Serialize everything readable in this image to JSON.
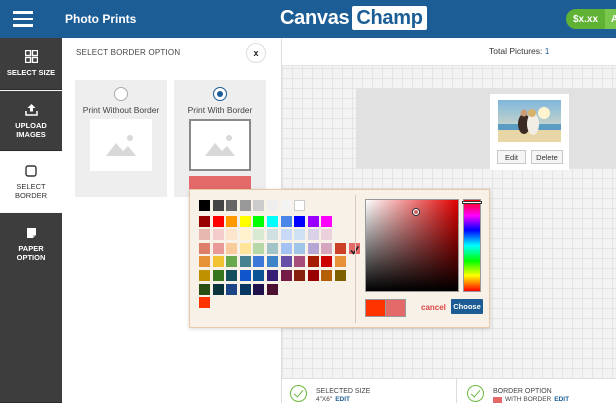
{
  "header": {
    "app_title": "Photo Prints",
    "logo_part1": "Canvas",
    "logo_part2": "Champ",
    "price": "$x.xx",
    "price_action": "A"
  },
  "sidebar": {
    "items": [
      {
        "label_line1": "SELECT SIZE",
        "label_line2": "",
        "icon": "grid-icon"
      },
      {
        "label_line1": "UPLOAD",
        "label_line2": "IMAGES",
        "icon": "upload-icon"
      },
      {
        "label_line1": "SELECT",
        "label_line2": "BORDER",
        "icon": "square-icon"
      },
      {
        "label_line1": "PAPER",
        "label_line2": "OPTION",
        "icon": "paper-icon"
      }
    ]
  },
  "panel": {
    "title": "SELECT BORDER OPTION",
    "close_label": "x",
    "options": [
      {
        "label": "Print Without Border",
        "selected": false
      },
      {
        "label": "Print With Border",
        "selected": true
      }
    ],
    "border_color": "#e46a6a"
  },
  "canvas": {
    "total_label": "Total Pictures: ",
    "total_value": "1",
    "edit_label": "Edit",
    "delete_label": "Delete"
  },
  "footer": {
    "selected_size_label": "SELECTED SIZE",
    "selected_size_value": "4\"X6\"",
    "border_option_label": "BORDER OPTION",
    "border_option_value": "WITH BORDER",
    "edit_label": "EDIT"
  },
  "color_picker": {
    "palette_rows": [
      [
        "#000000",
        "#444444",
        "#666666",
        "#999999",
        "#cccccc",
        "#eeeeee",
        "#f3f3f3",
        "#ffffff"
      ],
      [
        "#990000",
        "#ff0000",
        "#ff9900",
        "#ffff00",
        "#00ff00",
        "#00ffff",
        "#4a86e8",
        "#0000ff",
        "#9900ff",
        "#ff00ff"
      ],
      [
        "#e6b8af",
        "#f4cccc",
        "#fce5cd",
        "#fff2cc",
        "#d9ead3",
        "#d0e0e3",
        "#c9daf8",
        "#cfe2f3",
        "#d9d2e9",
        "#ead1dc"
      ],
      [
        "#dd7e6b",
        "#ea9999",
        "#f9cb9c",
        "#ffe599",
        "#b6d7a8",
        "#a2c4c9",
        "#a4c2f4",
        "#9fc5e8",
        "#b4a7d6",
        "#d5a6bd",
        "#cc4125",
        "#e46a6a"
      ],
      [
        "#e69138",
        "#f1c232",
        "#6aa84f",
        "#45818e",
        "#3c78d8",
        "#3d85c6",
        "#674ea7",
        "#a64d79",
        "#a61c00",
        "#cc0000",
        "#e69138"
      ],
      [
        "#bf9000",
        "#38761d",
        "#134f5c",
        "#1155cc",
        "#0b5394",
        "#351c75",
        "#741b47",
        "#85200c",
        "#990000",
        "#b45f06",
        "#7f6000"
      ],
      [
        "#274e13",
        "#0c343d",
        "#1c4587",
        "#073763",
        "#20124d",
        "#4c1130"
      ],
      [
        "#ff3300"
      ]
    ],
    "selected_hex": "#e46a6a",
    "preview_new": "#ff3300",
    "preview_old": "#e46a6a",
    "cancel_label": "cancel",
    "choose_label": "Choose"
  },
  "colors": {
    "brand_blue": "#1d5d96",
    "accent_green": "#5fb233",
    "sidebar_dark": "#3d3d3d",
    "border_red": "#e46a6a"
  }
}
